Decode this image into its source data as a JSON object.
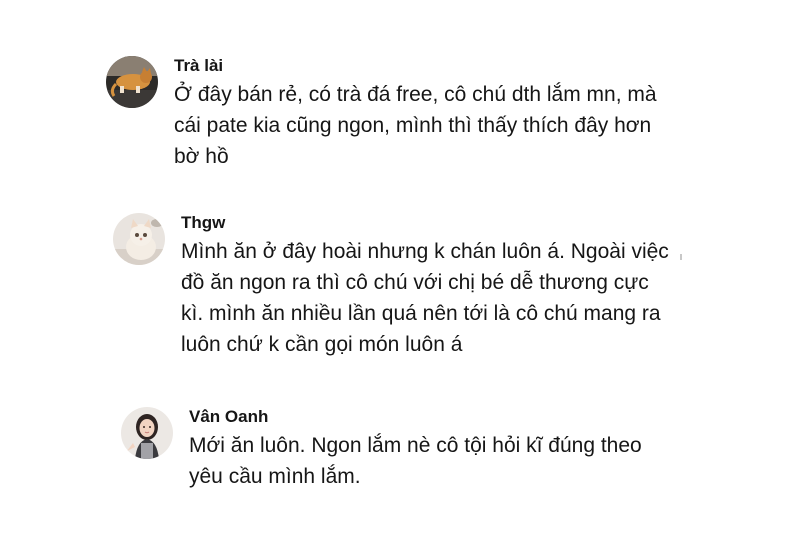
{
  "comments": [
    {
      "author": "Trà lài",
      "avatar_icon": "cat-avatar-icon",
      "lines": [
        "Ở đây bán rẻ, có trà đá free, cô chú dth lắm mn, mà",
        "cái pate kia cũng ngon, mình thì thấy thích đây hơn",
        "bờ hồ"
      ]
    },
    {
      "author": "Thgw",
      "avatar_icon": "kitten-avatar-icon",
      "lines": [
        "Mình ăn ở đây hoài nhưng k chán luôn á. Ngoài việc",
        "đồ ăn ngon ra thì cô chú với chị bé dễ thương cực",
        "kì. mình ăn nhiều lần quá nên tới là cô chú mang ra",
        "luôn chứ k cần gọi món luôn á"
      ]
    },
    {
      "author": "Vân Oanh",
      "avatar_icon": "girl-avatar-icon",
      "lines": [
        "Mới ăn luôn. Ngon lắm nè cô tội hỏi kĩ đúng theo",
        "yêu cầu mình lắm."
      ]
    }
  ]
}
